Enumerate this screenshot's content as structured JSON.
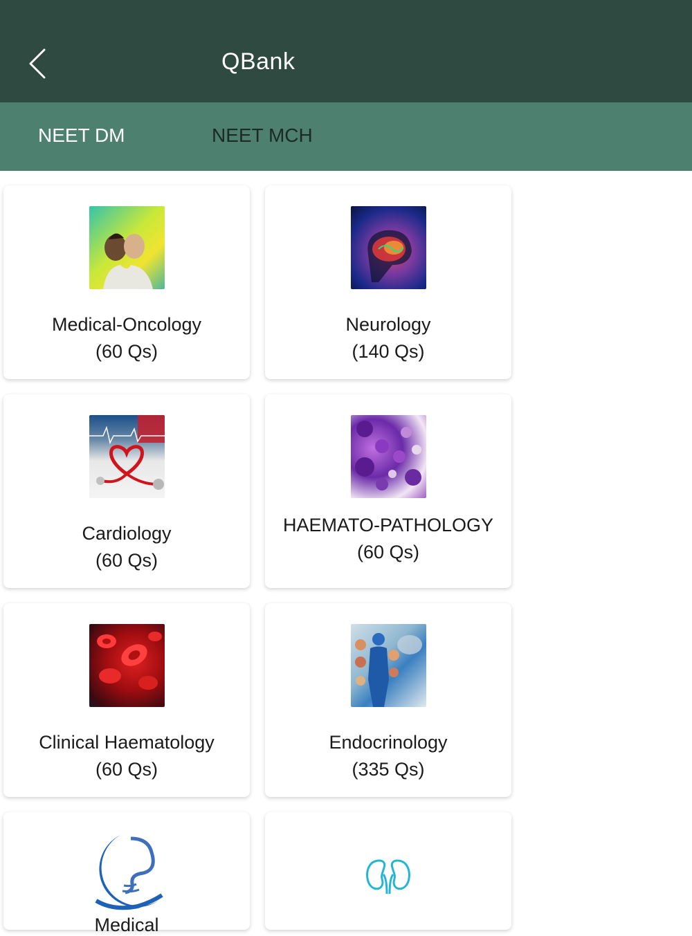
{
  "header": {
    "title": "QBank",
    "back_icon": "chevron-left-icon"
  },
  "tabs": [
    {
      "label": "NEET DM",
      "active": true
    },
    {
      "label": "NEET MCH",
      "active": false
    }
  ],
  "colors": {
    "header_bg": "#2f4a40",
    "tabs_bg": "#4e8070",
    "active_tab_text": "#ffffff",
    "inactive_tab_text": "#1c2a24"
  },
  "cards": [
    {
      "name": "Medical-Oncology",
      "count": "(60 Qs)",
      "icon": "oncology-photo"
    },
    {
      "name": "Neurology",
      "count": "(140 Qs)",
      "icon": "brain-photo"
    },
    {
      "name": "Cardiology",
      "count": "(60 Qs)",
      "icon": "stethoscope-heart-photo"
    },
    {
      "name": "HAEMATO-PATHOLOGY",
      "count": "(60 Qs)",
      "icon": "blood-cells-microscopy-photo"
    },
    {
      "name": "Clinical Haematology",
      "count": "(60 Qs)",
      "icon": "red-blood-cells-photo"
    },
    {
      "name": "Endocrinology",
      "count": "(335 Qs)",
      "icon": "endocrine-system-photo"
    },
    {
      "name": "Medical",
      "count": "",
      "icon": "stomach-hand-icon"
    },
    {
      "name": "",
      "count": "",
      "icon": "kidneys-icon"
    }
  ]
}
